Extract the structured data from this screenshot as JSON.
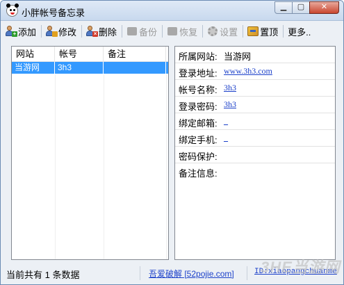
{
  "window": {
    "title": "小胖帐号备忘录"
  },
  "toolbar": {
    "items": [
      {
        "label": "添加",
        "icon": "add-user-icon",
        "enabled": true
      },
      {
        "label": "修改",
        "icon": "edit-user-icon",
        "enabled": true
      },
      {
        "label": "删除",
        "icon": "delete-user-icon",
        "enabled": true
      },
      {
        "label": "备份",
        "icon": "backup-icon",
        "enabled": false
      },
      {
        "label": "恢复",
        "icon": "restore-icon",
        "enabled": false
      },
      {
        "label": "设置",
        "icon": "gear-icon",
        "enabled": false
      },
      {
        "label": "置顶",
        "icon": "pin-icon",
        "enabled": true
      },
      {
        "label": "更多..",
        "icon": "",
        "enabled": true
      }
    ]
  },
  "list": {
    "columns": [
      "网站",
      "帐号",
      "备注"
    ],
    "rows": [
      {
        "site": "当游网",
        "account": "3h3",
        "note": ""
      }
    ]
  },
  "detail": {
    "rows": [
      {
        "label": "所属网站:",
        "value": "当游网",
        "link": false
      },
      {
        "label": "登录地址:",
        "value": "www.3h3.com",
        "link": true
      },
      {
        "label": "帐号名称:",
        "value": "3h3",
        "link": true
      },
      {
        "label": "登录密码:",
        "value": "3h3",
        "link": true
      },
      {
        "label": "绑定邮箱:",
        "value": "_",
        "link": true
      },
      {
        "label": "绑定手机:",
        "value": "_",
        "link": true
      },
      {
        "label": "密码保护:",
        "value": "",
        "link": false
      },
      {
        "label": "备注信息:",
        "value": "",
        "link": false
      }
    ]
  },
  "status": {
    "count_text": "当前共有 1 条数据",
    "link1": "吾爱破解 [52pojie.com]",
    "link2": "ID:xiaopangchuanme"
  },
  "watermark": "3HE当游网",
  "colors": {
    "selection": "#3399ff",
    "link": "#1a3fc9",
    "accent_close": "#c9462f"
  }
}
